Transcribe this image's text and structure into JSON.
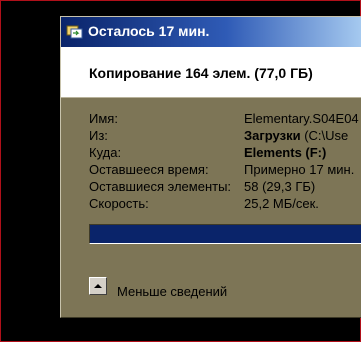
{
  "window": {
    "title": "Осталось 17 мин.",
    "icon": "copy-files-icon"
  },
  "header": {
    "text": "Копирование 164 элем. (77,0 ГБ)"
  },
  "details": {
    "name_label": "Имя:",
    "name_value": "Elementary.S04E04",
    "from_label": "Из:",
    "from_folder": "Загрузки",
    "from_path": " (C:\\Use",
    "to_label": "Куда:",
    "to_drive": "Elements (F:)",
    "time_label": "Оставшееся время:",
    "time_value": "Примерно 17 мин.",
    "items_label": "Оставшиеся элементы:",
    "items_value": "58 (29,3 ГБ)",
    "speed_label": "Скорость:",
    "speed_value": "25,2 МБ/сек."
  },
  "progress": {
    "percent": 100,
    "fill_color": "#0a246a"
  },
  "footer": {
    "toggle_icon": "chevron-up-icon",
    "toggle_label": "Меньше сведений"
  },
  "colors": {
    "dialog_background": "#7d7556",
    "title_gradient_start": "#0a246a",
    "title_gradient_end": "#a6caf0",
    "outer_border": "#b0101a"
  }
}
